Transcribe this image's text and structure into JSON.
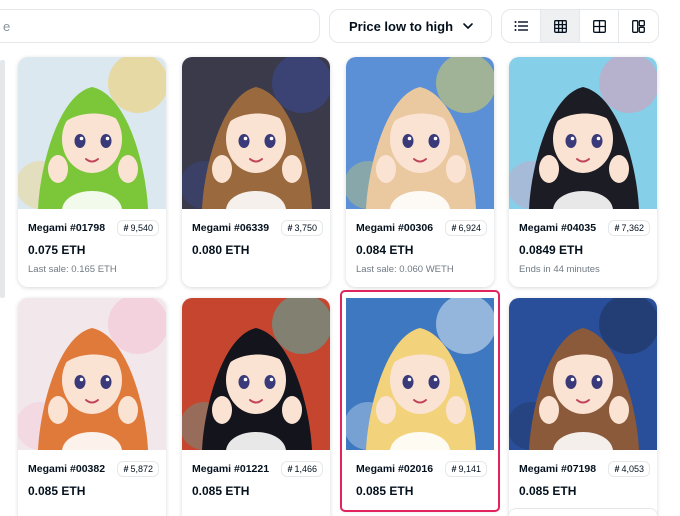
{
  "search": {
    "visible_fragment": "e"
  },
  "sort": {
    "selected": "Price low to high"
  },
  "view_modes": [
    {
      "icon": "list-view-icon",
      "active": false
    },
    {
      "icon": "grid-small-icon",
      "active": true
    },
    {
      "icon": "grid-large-icon",
      "active": false
    },
    {
      "icon": "masonry-view-icon",
      "active": false
    }
  ],
  "items": [
    {
      "name": "Megami #01798",
      "rank": "9,540",
      "price": "0.075 ETH",
      "sub": "Last sale: 0.165 ETH",
      "hair": "#7cc63a",
      "bg": "#dce8ef",
      "accent": "#f5c84a"
    },
    {
      "name": "Megami #06339",
      "rank": "3,750",
      "price": "0.080 ETH",
      "sub": "",
      "hair": "#9a6a3e",
      "bg": "#3a3a4a",
      "accent": "#3b4fa8"
    },
    {
      "name": "Megami #00306",
      "rank": "6,924",
      "price": "0.084 ETH",
      "sub": "Last sale: 0.060 WETH",
      "hair": "#eac9a0",
      "bg": "#5b8fd6",
      "accent": "#f3e04a"
    },
    {
      "name": "Megami #04035",
      "rank": "7,362",
      "price": "0.0849 ETH",
      "sub": "Ends in 44 minutes",
      "hair": "#1c1c24",
      "bg": "#86cfe8",
      "accent": "#f28fb0"
    },
    {
      "name": "Megami #00382",
      "rank": "5,872",
      "price": "0.085 ETH",
      "sub": "",
      "hair": "#e07a3a",
      "bg": "#f2e7ea",
      "accent": "#f6b8cf"
    },
    {
      "name": "Megami #01221",
      "rank": "1,466",
      "price": "0.085 ETH",
      "sub": "",
      "hair": "#14141c",
      "bg": "#c6452e",
      "accent": "#2fc8c0"
    },
    {
      "name": "Megami #02016",
      "rank": "9,141",
      "price": "0.085 ETH",
      "sub": "",
      "hair": "#f2d27a",
      "bg": "#3d78c0",
      "accent": "#ffffff"
    },
    {
      "name": "Megami #07198",
      "rank": "4,053",
      "price": "0.085 ETH",
      "sub": "",
      "hair": "#8a5a3a",
      "bg": "#2a4f9a",
      "accent": "#1b2a48"
    }
  ],
  "selected_item": "Megami #02016"
}
